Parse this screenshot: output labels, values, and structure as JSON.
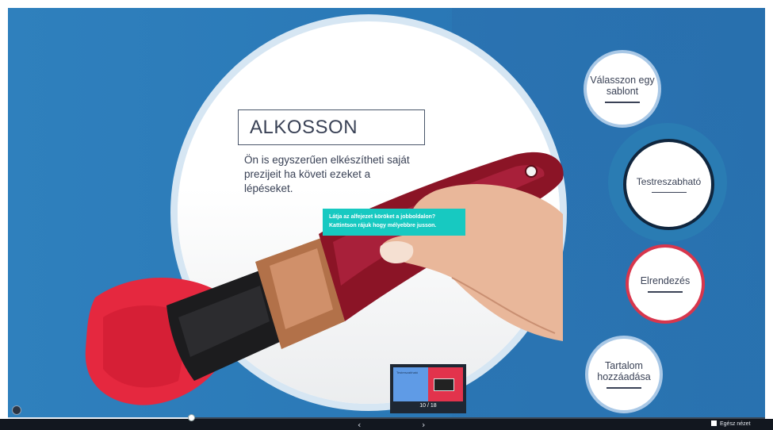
{
  "slide": {
    "title": "ALKOSSON",
    "lead": "Ön is egyszerűen elkészítheti saját prezijeit ha követi ezeket a lépéseket.",
    "tooltip": "Látja az alfejezet köröket a jobboldalon? Kattintson rájuk hogy mélyebbre jusson."
  },
  "nodes": [
    {
      "label": "Válasszon egy sablont"
    },
    {
      "label": "Testreszabható"
    },
    {
      "label": "Elrendezés"
    },
    {
      "label": "Tartalom hozzáadása"
    }
  ],
  "thumbnail": {
    "counter": "10 / 18",
    "left_text": "Testreszabható"
  },
  "player": {
    "progress": 0.24,
    "prev": "‹",
    "next": "›",
    "fullscreen": "Egész nézet"
  },
  "colors": {
    "background": "#2f80bd",
    "accent_red": "#e2334c",
    "accent_teal": "#17c9c1",
    "dark_text": "#3a4256"
  },
  "icons": {
    "home": "home-icon",
    "prev": "chevron-left-icon",
    "next": "chevron-right-icon"
  }
}
